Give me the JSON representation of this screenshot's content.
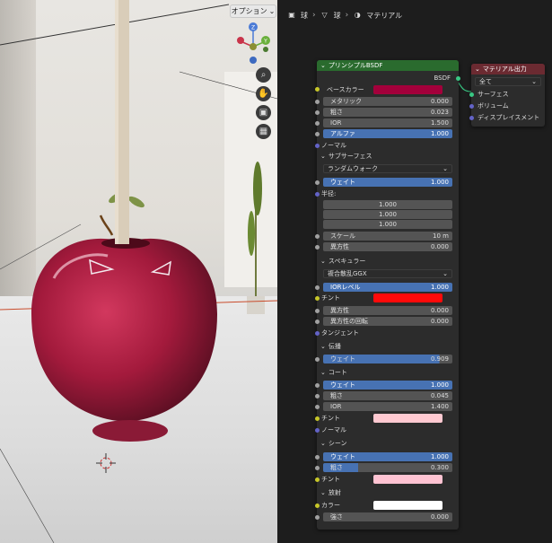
{
  "viewport": {
    "options_label": "オプション",
    "gizmo": {
      "x": "X",
      "y": "Y",
      "z": "Z"
    }
  },
  "breadcrumb": {
    "item1": "球",
    "item2": "球",
    "item3": "マテリアル"
  },
  "bsdf": {
    "title": "プリンシプルBSDF",
    "output": "BSDF",
    "base_color_label": "ベースカラー",
    "base_color": "#a3003b",
    "metallic": {
      "label": "メタリック",
      "value": "0.000"
    },
    "roughness": {
      "label": "粗さ",
      "value": "0.023"
    },
    "ior": {
      "label": "IOR",
      "value": "1.500"
    },
    "alpha": {
      "label": "アルファ",
      "value": "1.000"
    },
    "normal": "ノーマル",
    "subsurface": {
      "title": "サブサーフェス",
      "method": "ランダムウォーク",
      "weight": {
        "label": "ウェイト",
        "value": "1.000"
      },
      "radius_label": "半径:",
      "radius": [
        "1.000",
        "1.000",
        "1.000"
      ],
      "scale": {
        "label": "スケール",
        "value": "10 m"
      },
      "anisotropy": {
        "label": "異方性",
        "value": "0.000"
      }
    },
    "specular": {
      "title": "スペキュラー",
      "distribution": "複合散乱GGX",
      "ior_level": {
        "label": "IORレベル",
        "value": "1.000"
      },
      "tint_label": "チント",
      "tint_color": "#ff0a0a",
      "anisotropic": {
        "label": "異方性",
        "value": "0.000"
      },
      "anisotropic_rotation": {
        "label": "異方性の回転",
        "value": "0.000"
      },
      "tangent": "タンジェント"
    },
    "transmission": {
      "title": "伝播",
      "weight": {
        "label": "ウェイト",
        "value": "0.909"
      }
    },
    "coat": {
      "title": "コート",
      "weight": {
        "label": "ウェイト",
        "value": "1.000"
      },
      "roughness": {
        "label": "粗さ",
        "value": "0.045"
      },
      "ior": {
        "label": "IOR",
        "value": "1.400"
      },
      "tint_label": "チント",
      "tint_color": "#ffc9d1",
      "normal": "ノーマル"
    },
    "sheen": {
      "title": "シーン",
      "weight": {
        "label": "ウェイト",
        "value": "1.000"
      },
      "roughness": {
        "label": "粗さ",
        "value": "0.300"
      },
      "tint_label": "チント",
      "tint_color": "#ffc3d2"
    },
    "emission": {
      "title": "放射",
      "color_label": "カラー",
      "color": "#ffffff",
      "strength": {
        "label": "強さ",
        "value": "0.000"
      }
    }
  },
  "material_output": {
    "title": "マテリアル出力",
    "target": "全て",
    "surface": "サーフェス",
    "volume": "ボリューム",
    "displacement": "ディスプレイスメント"
  }
}
